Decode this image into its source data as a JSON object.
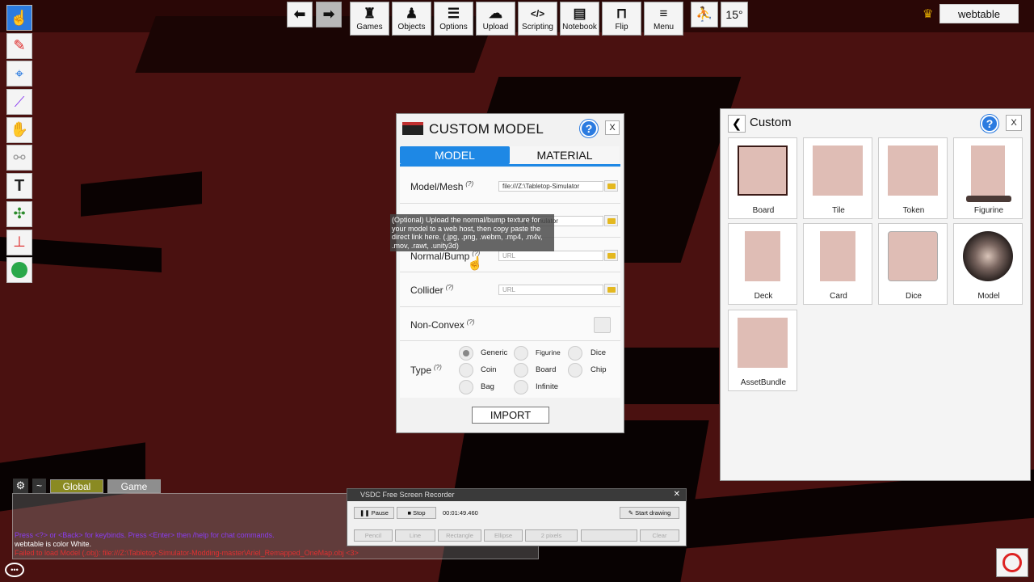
{
  "top_toolbar": {
    "back_icon": "arrow-left-icon",
    "forward_icon": "arrow-right-icon",
    "buttons": [
      {
        "label": "Games",
        "icon": "games-icon"
      },
      {
        "label": "Objects",
        "icon": "objects-icon"
      },
      {
        "label": "Options",
        "icon": "options-icon"
      },
      {
        "label": "Upload",
        "icon": "upload-icon"
      },
      {
        "label": "Scripting",
        "icon": "scripting-icon"
      },
      {
        "label": "Notebook",
        "icon": "notebook-icon"
      },
      {
        "label": "Flip",
        "icon": "flip-icon"
      },
      {
        "label": "Menu",
        "icon": "menu-icon"
      }
    ],
    "rotation": "15°"
  },
  "player": {
    "name": "webtable",
    "host_icon": "crown-icon"
  },
  "left_tools": [
    "pointer-icon",
    "pen-icon",
    "map-pin-icon",
    "line-icon",
    "hand-icon",
    "joint-icon",
    "text-icon",
    "gizmo-icon",
    "snap-icon",
    "green-ball-icon"
  ],
  "custom_model": {
    "title": "CUSTOM MODEL",
    "help": "?",
    "close": "X",
    "tabs": {
      "model": "MODEL",
      "material": "MATERIAL"
    },
    "fields": {
      "model_mesh": {
        "label": "Model/Mesh",
        "hint": "(?)",
        "value": "file:///Z:\\Tabletop-Simulator"
      },
      "diffuse": {
        "value": "\\Tabletop-Simulator"
      },
      "normal": {
        "label": "Normal/Bump",
        "hint": "(?)",
        "placeholder": "URL"
      },
      "collider": {
        "label": "Collider",
        "hint": "(?)",
        "placeholder": "URL"
      },
      "non_convex": {
        "label": "Non-Convex",
        "hint": "(?)",
        "checked": false
      }
    },
    "type": {
      "label": "Type",
      "hint": "(?)",
      "selected": "Generic",
      "options": [
        "Generic",
        "Figurine",
        "Dice",
        "Coin",
        "Board",
        "Chip",
        "Bag",
        "Infinite"
      ]
    },
    "import_label": "IMPORT",
    "tooltip": "(Optional) Upload the normal/bump texture for your model to a web host, then copy paste the direct link here. (.jpg, .png, .webm, .mp4, .m4v, .mov, .rawt, .unity3d)"
  },
  "custom_panel": {
    "title": "Custom",
    "help": "?",
    "close": "X",
    "items": [
      "Board",
      "Tile",
      "Token",
      "Figurine",
      "Deck",
      "Card",
      "Dice",
      "Model",
      "AssetBundle"
    ]
  },
  "chat": {
    "tabs": {
      "global": "Global",
      "game": "Game"
    },
    "tilde": "~",
    "lines": [
      {
        "text": "Press <?> or <Back> for keybinds. Press <Enter> then /help for chat commands.",
        "color": "#8a3cf0"
      },
      {
        "text": "webtable is color White.",
        "color": "#ffffff"
      },
      {
        "text": "Failed to load Model (.obj): file:///Z:\\Tabletop-Simulator-Modding-master\\Ariel_Remapped_OneMap.obj <3>",
        "color": "#e03030"
      }
    ]
  },
  "recorder": {
    "title": "VSDC Free Screen Recorder",
    "pause": "Pause",
    "stop": "Stop",
    "time": "00:01:49.460",
    "start_drawing": "Start drawing",
    "pencil": "Pencil",
    "line": "Line",
    "rectangle": "Rectangle",
    "ellipse": "Ellipse",
    "pixels": "2 pixels",
    "clear": "Clear"
  }
}
